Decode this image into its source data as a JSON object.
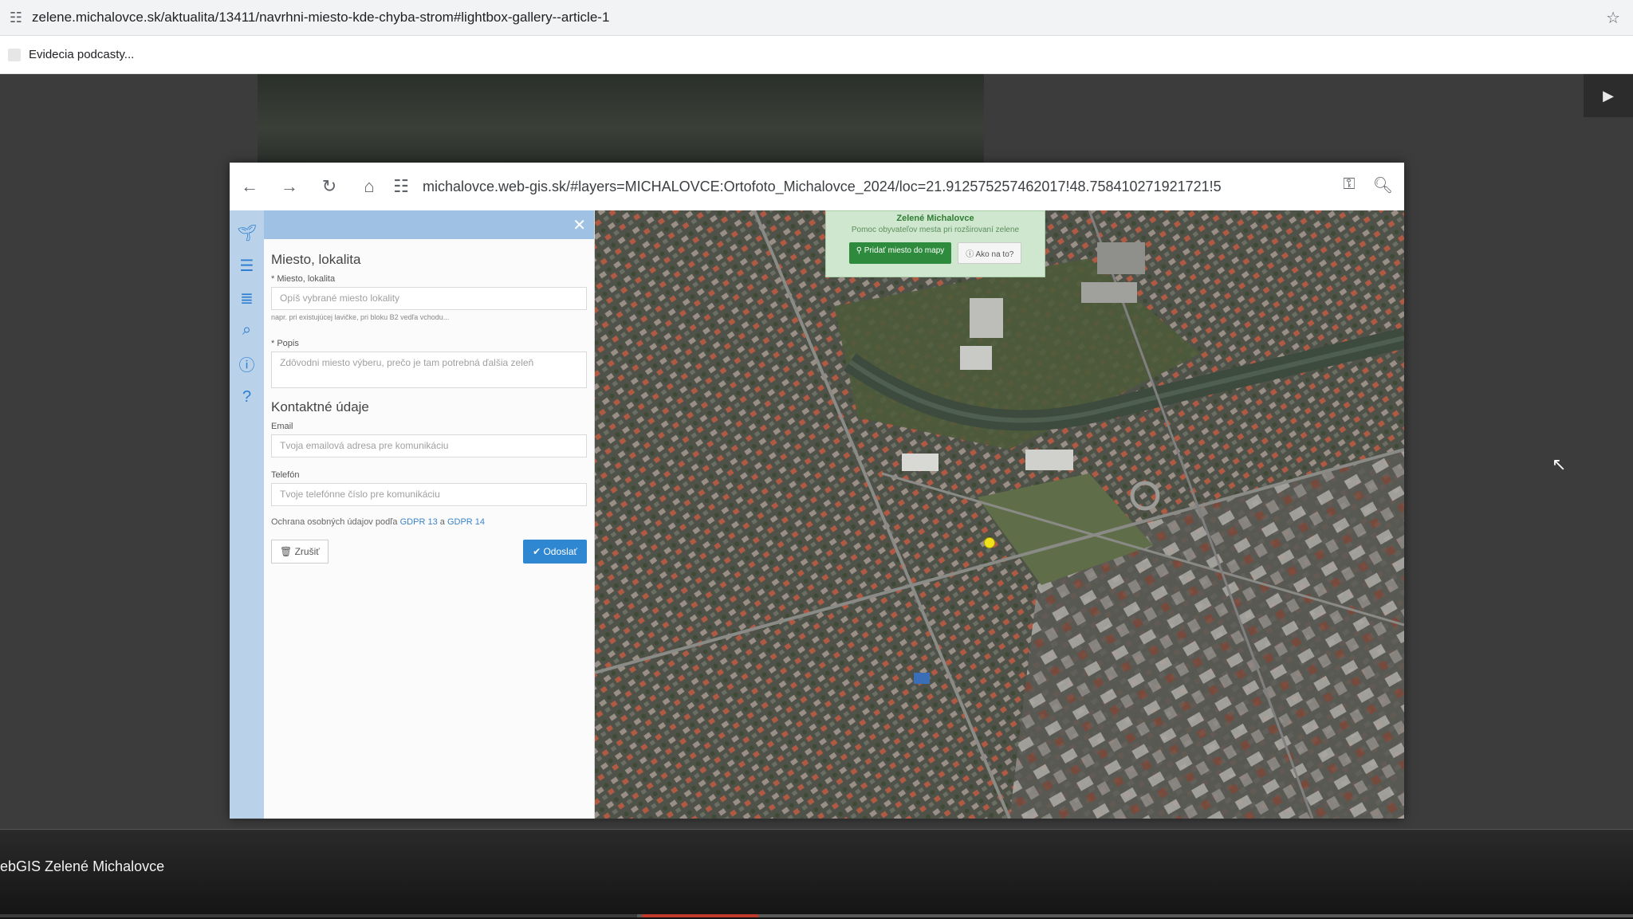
{
  "outer_browser": {
    "url": "zelene.michalovce.sk/aktualita/13411/navrhni-miesto-kde-chyba-strom#lightbox-gallery--article-1",
    "bookmark": "Evidecia podcasty..."
  },
  "inner_browser": {
    "url": "michalovce.web-gis.sk/#layers=MICHALOVCE:Ortofoto_Michalovce_2024/loc=21.912575257462017!48.758410271921721!5"
  },
  "form": {
    "section1_title": "Miesto, lokalita",
    "place_label": "* Miesto, lokalita",
    "place_placeholder": "Opíš vybrané miesto lokality",
    "place_hint": "napr. pri existujúcej lavičke, pri bloku B2 vedľa vchodu...",
    "description_label": "* Popis",
    "description_placeholder": "Zdôvodni miesto výberu, prečo je tam potrebná ďalšia zeleň",
    "section2_title": "Kontaktné údaje",
    "email_label": "Email",
    "email_placeholder": "Tvoja emailová adresa pre komunikáciu",
    "phone_label": "Telefón",
    "phone_placeholder": "Tvoje telefónne číslo pre komunikáciu",
    "gdpr_text": "Ochrana osobných údajov podľa",
    "gdpr_link1": "GDPR 13",
    "gdpr_and": "a",
    "gdpr_link2": "GDPR 14",
    "cancel_label": "Zrušiť",
    "send_label": "Odoslať"
  },
  "map": {
    "banner_title": "Zelené Michalovce",
    "banner_subtitle": "Pomoc obyvateľov mesta pri rozširovaní zelene",
    "add_button": "Pridať miesto do mapy",
    "how_button": "Ako na to?"
  },
  "video": {
    "title": "ebGIS Zelené Michalovce",
    "progress_fraction": 0.39
  },
  "colors": {
    "accent_blue": "#2f86d1",
    "green_button": "#2e8b3d",
    "marker_yellow": "#f2e21a"
  }
}
